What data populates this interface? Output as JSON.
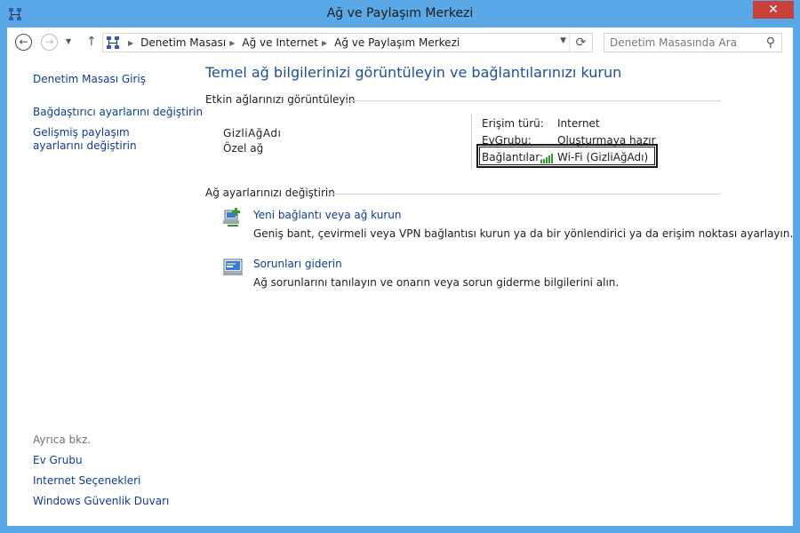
{
  "window": {
    "title": "Ağ ve Paylaşım Merkezi",
    "close_glyph": "✕"
  },
  "nav": {
    "back_glyph": "←",
    "forward_glyph": "→",
    "recent_glyph": "▼",
    "up_glyph": "↑"
  },
  "breadcrumb": {
    "items": [
      "Denetim Masası",
      "Ağ ve Internet",
      "Ağ ve Paylaşım Merkezi"
    ],
    "separator": "▶",
    "dropdown_glyph": "▼",
    "refresh_glyph": "⟳"
  },
  "search": {
    "placeholder": "Denetim Masasında Ara",
    "icon": "search-icon",
    "glyph": "⚲"
  },
  "sidebar": {
    "home": "Denetim Masası Giriş",
    "links": [
      "Bağdaştırıcı ayarlarını değiştirin",
      "Gelişmiş paylaşım ayarlarını değiştirin"
    ],
    "see_also_label": "Ayrıca bkz.",
    "see_also": [
      "Ev Grubu",
      "Internet Seçenekleri",
      "Windows Güvenlik Duvarı"
    ]
  },
  "main": {
    "heading": "Temel ağ bilgilerinizi görüntüleyin ve bağlantılarınızı kurun",
    "active_section": "Etkin ağlarınızı görüntüleyin",
    "network": {
      "name": "GizliAğAdı",
      "type": "Özel ağ",
      "access_label": "Erişim türü:",
      "access_value": "Internet",
      "homegroup_label": "EvGrubu:",
      "homegroup_value": "Oluşturmaya hazır",
      "connections_label": "Bağlantılar:",
      "connection_value": "Wi-Fi (GizliAğAdı)"
    },
    "change_section": "Ağ ayarlarınızı değiştirin",
    "tasks": [
      {
        "title": "Yeni bağlantı veya ağ kurun",
        "description": "Geniş bant, çevirmeli veya VPN bağlantısı kurun ya da bir yönlendirici ya da erişim noktası ayarlayın.",
        "icon": "network-setup-icon"
      },
      {
        "title": "Sorunları giderin",
        "description": "Ağ sorunlarını tanılayın ve onarın veya sorun giderme bilgilerini alın.",
        "icon": "troubleshoot-icon"
      }
    ]
  },
  "colors": {
    "frame": "#5aa9e6",
    "close": "#c7413b",
    "link": "#0f3b93",
    "heading": "#1f4e9b",
    "wifi": "#2e9b2e"
  }
}
